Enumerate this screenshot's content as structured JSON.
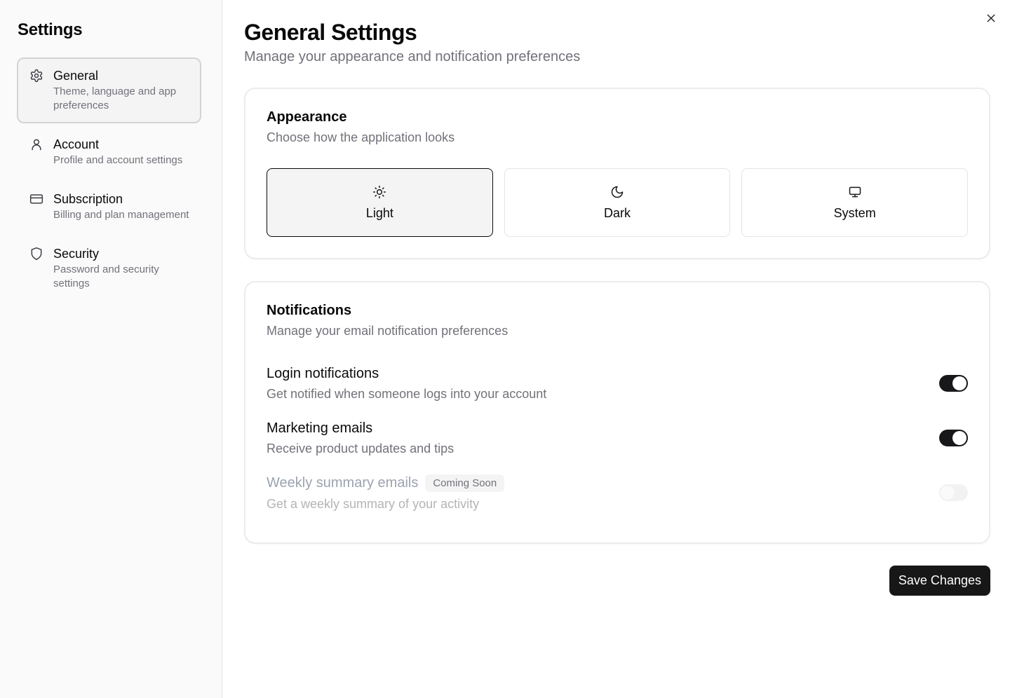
{
  "sidebar": {
    "title": "Settings",
    "items": [
      {
        "label": "General",
        "desc": "Theme, language and app preferences",
        "icon": "gear-icon",
        "active": true
      },
      {
        "label": "Account",
        "desc": "Profile and account settings",
        "icon": "user-icon"
      },
      {
        "label": "Subscription",
        "desc": "Billing and plan management",
        "icon": "credit-card-icon"
      },
      {
        "label": "Security",
        "desc": "Password and security settings",
        "icon": "shield-icon"
      }
    ]
  },
  "main": {
    "title": "General Settings",
    "subtitle": "Manage your appearance and notification preferences",
    "appearance": {
      "title": "Appearance",
      "desc": "Choose how the application looks",
      "options": [
        {
          "label": "Light",
          "icon": "sun-icon",
          "selected": true
        },
        {
          "label": "Dark",
          "icon": "moon-icon"
        },
        {
          "label": "System",
          "icon": "monitor-icon"
        }
      ]
    },
    "notifications": {
      "title": "Notifications",
      "desc": "Manage your email notification preferences",
      "items": [
        {
          "title": "Login notifications",
          "desc": "Get notified when someone logs into your account",
          "enabled": true
        },
        {
          "title": "Marketing emails",
          "desc": "Receive product updates and tips",
          "enabled": true
        },
        {
          "title": "Weekly summary emails",
          "desc": "Get a weekly summary of your activity",
          "badge": "Coming Soon",
          "enabled": false,
          "disabled": true
        }
      ]
    },
    "save_label": "Save Changes"
  },
  "colors": {
    "accent": "#171717",
    "muted_text": "#71717a",
    "sidebar_bg": "#fafafa"
  }
}
